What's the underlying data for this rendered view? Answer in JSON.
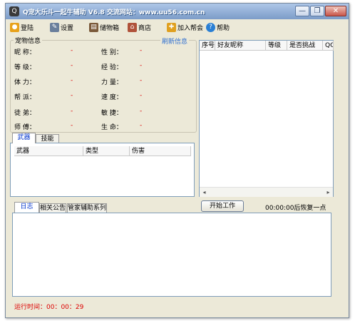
{
  "window": {
    "title": "Q宠大乐斗一起牛辅助 V6.8 交流网站：www.uu56.com.cn",
    "icon_glyph": "Q",
    "minimize_glyph": "—",
    "restore_glyph": "❐",
    "close_glyph": "✕"
  },
  "toolbar": {
    "items": [
      {
        "label": "登陆",
        "icon": "login-icon",
        "glyph": "●",
        "color": "#e8a21a"
      },
      {
        "label": "设置",
        "icon": "wrench-icon",
        "glyph": "✎",
        "color": "#6a7f9c"
      },
      {
        "label": "储物箱",
        "icon": "box-icon",
        "glyph": "▤",
        "color": "#7b5a3a"
      },
      {
        "label": "商店",
        "icon": "shop-icon",
        "glyph": "⌂",
        "color": "#b0523a"
      },
      {
        "label": "加入帮会",
        "icon": "join-guild-icon",
        "glyph": "✚",
        "color": "#e0a020"
      },
      {
        "label": "帮助",
        "icon": "help-icon",
        "glyph": "?",
        "color": "#2a7fd4"
      }
    ]
  },
  "pet_info": {
    "legend": "宠物信息",
    "refresh_label": "刷新信息",
    "rows": [
      {
        "left_label": "昵    称：",
        "left_value": "-",
        "right_label": "性    别：",
        "right_value": "-"
      },
      {
        "left_label": "等    级：",
        "left_value": "-",
        "right_label": "经    验：",
        "right_value": "-"
      },
      {
        "left_label": "体    力：",
        "left_value": "-",
        "right_label": "力    量：",
        "right_value": "-"
      },
      {
        "left_label": "帮    派：",
        "left_value": "-",
        "right_label": "速    度：",
        "right_value": "-"
      },
      {
        "left_label": "徒    弟：",
        "left_value": "-",
        "right_label": "敏    捷：",
        "right_value": "-"
      },
      {
        "left_label": "师    傅：",
        "left_value": "-",
        "right_label": "生    命：",
        "right_value": "-"
      }
    ]
  },
  "weapon_tabs": {
    "tabs": [
      "武器",
      "技能"
    ],
    "active": "武器",
    "columns": [
      "武器",
      "类型",
      "伤害"
    ]
  },
  "friend_list": {
    "columns": [
      "序号",
      "好友昵称",
      "等级",
      "是否挑战",
      "QQ"
    ],
    "scroll_left": "◂",
    "scroll_right": "▸"
  },
  "log_tabs": {
    "tabs": [
      "日志",
      "相关公告",
      "管家辅助系列"
    ],
    "active": "日志"
  },
  "controls": {
    "start_button": "开始工作",
    "recover_text": "00:00:00后恢复一点"
  },
  "status": {
    "runtime": "运行时间：00：00：29"
  }
}
